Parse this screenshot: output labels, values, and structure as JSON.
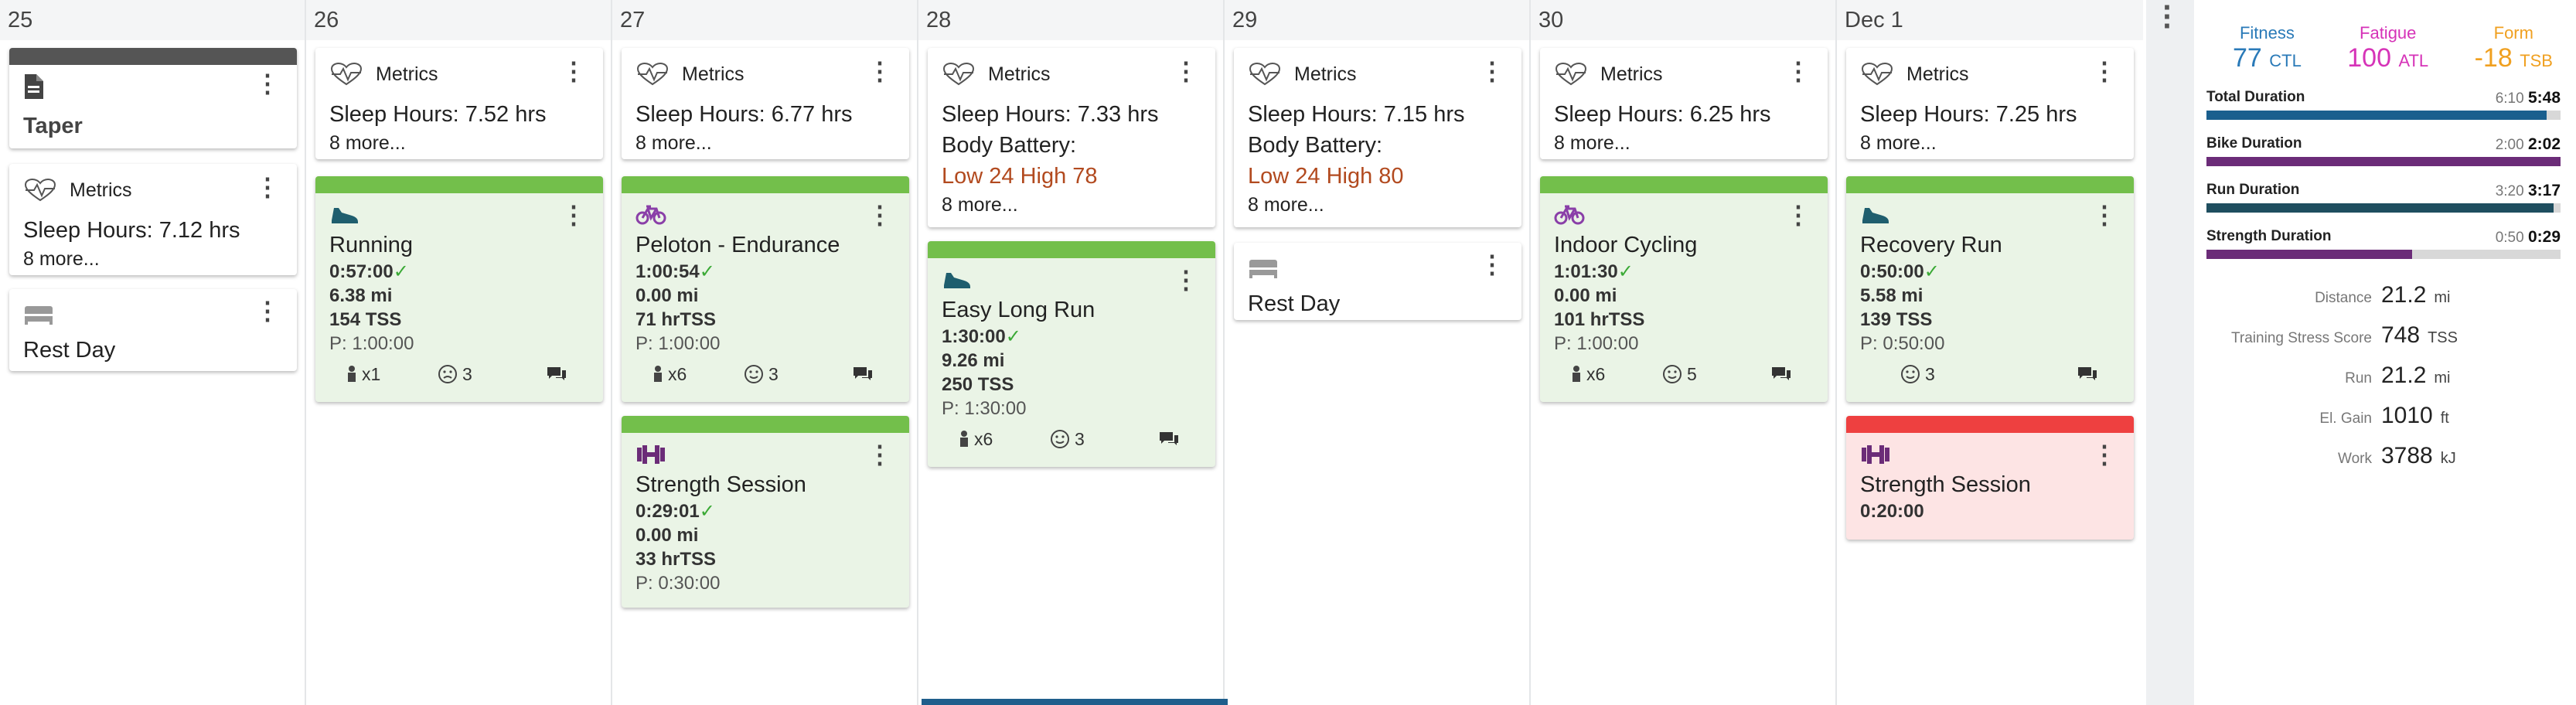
{
  "days": [
    {
      "label": "25"
    },
    {
      "label": "26"
    },
    {
      "label": "27"
    },
    {
      "label": "28"
    },
    {
      "label": "29"
    },
    {
      "label": "30"
    },
    {
      "label": "Dec 1"
    }
  ],
  "metrics_label": "Metrics",
  "more_label": "8 more...",
  "rest_label": "Rest Day",
  "taper_label": "Taper",
  "sleep": {
    "d25": "Sleep Hours: 7.12 hrs",
    "d26": "Sleep Hours: 7.52 hrs",
    "d27": "Sleep Hours: 6.77 hrs",
    "d28": "Sleep Hours: 7.33 hrs",
    "d29": "Sleep Hours: 7.15 hrs",
    "d30": "Sleep Hours: 6.25 hrs",
    "d1": "Sleep Hours: 7.25 hrs"
  },
  "body_battery_label": "Body Battery:",
  "battery": {
    "d28": "Low 24 High 78",
    "d29": "Low 24 High 80"
  },
  "workouts": {
    "running": {
      "title": "Running",
      "time": "0:57:00",
      "dist": "6.38 mi",
      "tss": "154 TSS",
      "plan": "P: 1:00:00",
      "reps": "x1",
      "mood": "3"
    },
    "peloton": {
      "title": "Peloton - Endurance",
      "time": "1:00:54",
      "dist": "0.00 mi",
      "tss": "71 hrTSS",
      "plan": "P: 1:00:00",
      "reps": "x6",
      "mood": "3"
    },
    "strength27": {
      "title": "Strength Session",
      "time": "0:29:01",
      "dist": "0.00 mi",
      "tss": "33 hrTSS",
      "plan": "P: 0:30:00"
    },
    "easylong": {
      "title": "Easy Long Run",
      "time": "1:30:00",
      "dist": "9.26 mi",
      "tss": "250 TSS",
      "plan": "P: 1:30:00",
      "reps": "x6",
      "mood": "3"
    },
    "indoor": {
      "title": "Indoor Cycling",
      "time": "1:01:30",
      "dist": "0.00 mi",
      "tss": "101 hrTSS",
      "plan": "P: 1:00:00",
      "reps": "x6",
      "mood": "5"
    },
    "recovery": {
      "title": "Recovery Run",
      "time": "0:50:00",
      "dist": "5.58 mi",
      "tss": "139 TSS",
      "plan": "P: 0:50:00",
      "mood": "3"
    },
    "strength1": {
      "title": "Strength Session",
      "time": "0:20:00"
    }
  },
  "check_mark": "✓",
  "summary": {
    "fitness": {
      "label": "Fitness",
      "value": "77",
      "unit": "CTL",
      "color": "#2a7ab8"
    },
    "fatigue": {
      "label": "Fatigue",
      "value": "100",
      "unit": "ATL",
      "color": "#d633b8"
    },
    "form": {
      "label": "Form",
      "value": "-18",
      "unit": "TSB",
      "color": "#f0a020"
    }
  },
  "durations": [
    {
      "label": "Total Duration",
      "planned": "6:10",
      "actual": "5:48",
      "fill": 0.96,
      "color": "#1a5f8e"
    },
    {
      "label": "Bike Duration",
      "planned": "2:00",
      "actual": "2:02",
      "fill": 1.0,
      "color": "#6b2c78"
    },
    {
      "label": "Run Duration",
      "planned": "3:20",
      "actual": "3:17",
      "fill": 0.98,
      "color": "#1f4e5f"
    },
    {
      "label": "Strength Duration",
      "planned": "0:50",
      "actual": "0:29",
      "fill": 0.58,
      "color": "#6b2c78"
    }
  ],
  "totals": [
    {
      "label": "Distance",
      "value": "21.2",
      "unit": "mi"
    },
    {
      "label": "Training Stress Score",
      "value": "748",
      "unit": "TSS"
    },
    {
      "label": "Run",
      "value": "21.2",
      "unit": "mi"
    },
    {
      "label": "El. Gain",
      "value": "1010",
      "unit": "ft"
    },
    {
      "label": "Work",
      "value": "3788",
      "unit": "kJ"
    }
  ]
}
